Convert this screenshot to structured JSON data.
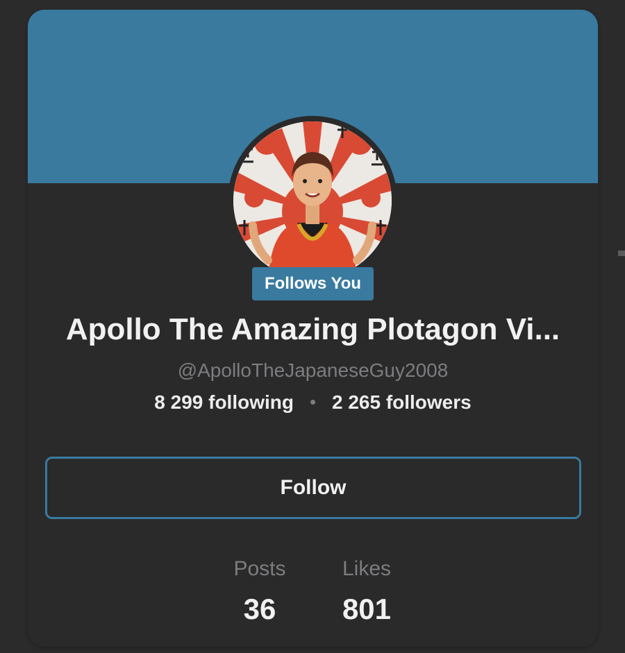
{
  "profile": {
    "display_name": "Apollo The Amazing Plotagon Vi...",
    "handle": "@ApolloTheJapaneseGuy2008",
    "follows_you_badge": "Follows You",
    "following_text": "8 299 following",
    "followers_text": "2 265 followers",
    "follow_button_label": "Follow",
    "avatar_icon": "avatar-image"
  },
  "metrics": {
    "posts_label": "Posts",
    "posts_value": "36",
    "likes_label": "Likes",
    "likes_value": "801"
  },
  "colors": {
    "accent": "#3a7a9f",
    "background": "#2a2a2b",
    "text_primary": "#f1f1f1",
    "text_secondary": "#7d7d80"
  }
}
